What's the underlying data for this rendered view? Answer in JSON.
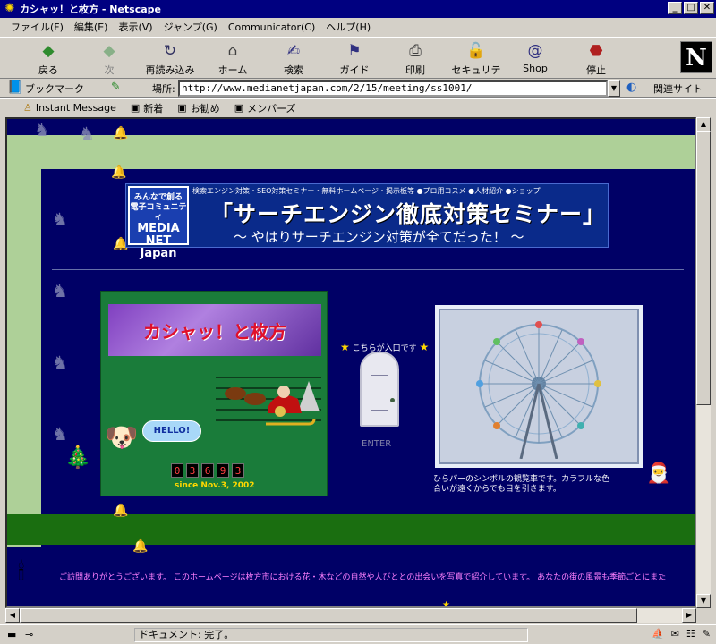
{
  "window": {
    "title": "カシャッ！と枚方 - Netscape"
  },
  "menu": [
    "ファイル(F)",
    "編集(E)",
    "表示(V)",
    "ジャンプ(G)",
    "Communicator(C)",
    "ヘルプ(H)"
  ],
  "nav": {
    "back": "戻る",
    "forward": "次",
    "reload": "再読み込み",
    "home": "ホーム",
    "search": "検索",
    "guide": "ガイド",
    "print": "印刷",
    "security": "セキュリティ",
    "shop": "Shop",
    "stop": "停止"
  },
  "location": {
    "bookmarks": "ブックマーク",
    "label": "場所:",
    "url": "http://www.medianetjapan.com/2/15/meeting/ss1001/",
    "related": "関連サイト"
  },
  "personal": [
    "Instant Message",
    "新着",
    "お勧め",
    "メンバーズ"
  ],
  "page": {
    "banner": {
      "logo_top": "みんなで創る",
      "logo_mid": "電子コミュニティ",
      "logo_brand": "MEDIA NET Japan",
      "topline": "検索エンジン対策・SEO対策セミナー・無料ホームページ・掲示板等 ●プロ用コスメ ●人材紹介 ●ショップ",
      "title": "「サーチエンジン徹底対策セミナー」",
      "subtitle": "～ やはりサーチエンジン対策が全てだった！ ～"
    },
    "site_title": "カシャッ！と枚方",
    "hello": "HELLO!",
    "counter": [
      "0",
      "3",
      "6",
      "9",
      "3"
    ],
    "since": "since Nov.3, 2002",
    "entrance": "こちらが入口です",
    "enter": "ENTER",
    "caption": "ひらパーのシンボルの観覧車です。カラフルな色合いが遠くからでも目を引きます。",
    "marquee": "ご訪問ありがとうございます。 このホームページは枚方市における花・木などの自然や人びととの出会いを写真で紹介しています。 あなたの街の風景も季節ごとにまた"
  },
  "status": {
    "text": "ドキュメント: 完了。"
  },
  "icons": {
    "app": "netscape-icon",
    "back": "back-arrow-icon",
    "forward": "forward-arrow-icon",
    "reload": "reload-icon",
    "home": "home-icon",
    "search": "search-icon",
    "guide": "guide-icon",
    "print": "printer-icon",
    "security": "lock-icon",
    "shop": "shop-icon",
    "stop": "stop-icon"
  },
  "colors": {
    "titlebar": "#000080",
    "page_bg": "#000066",
    "frame_light": "#aed098",
    "frame_dark": "#1a6e10",
    "panel": "#1a7c3a"
  }
}
